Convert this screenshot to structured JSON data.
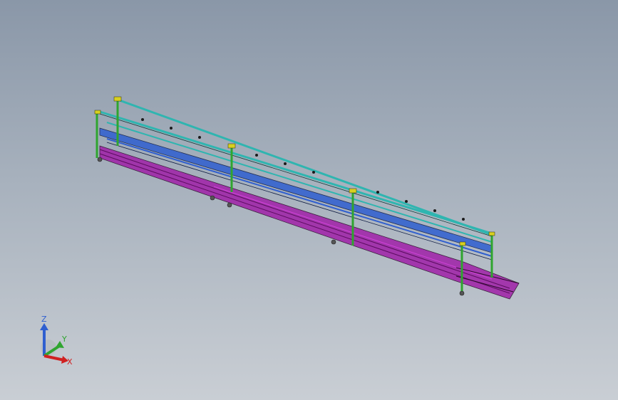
{
  "viewport": {
    "background_top": "#8a97a8",
    "background_bottom": "#c9ced4"
  },
  "model": {
    "name_icon": "conveyor-rack-assembly",
    "colors": {
      "frame_green": "#2fa52f",
      "top_rail_cyan": "#2fb5b0",
      "mid_rail_blue": "#2f5fd0",
      "base_magenta": "#a020a8",
      "accent_yellow": "#d8d020",
      "edge": "#1a1a1a"
    }
  },
  "triad": {
    "z_label": "Z",
    "y_label": "Y",
    "x_label": "X",
    "z_color": "#2f5fd0",
    "y_color": "#2fa52f",
    "x_color": "#d02020"
  }
}
